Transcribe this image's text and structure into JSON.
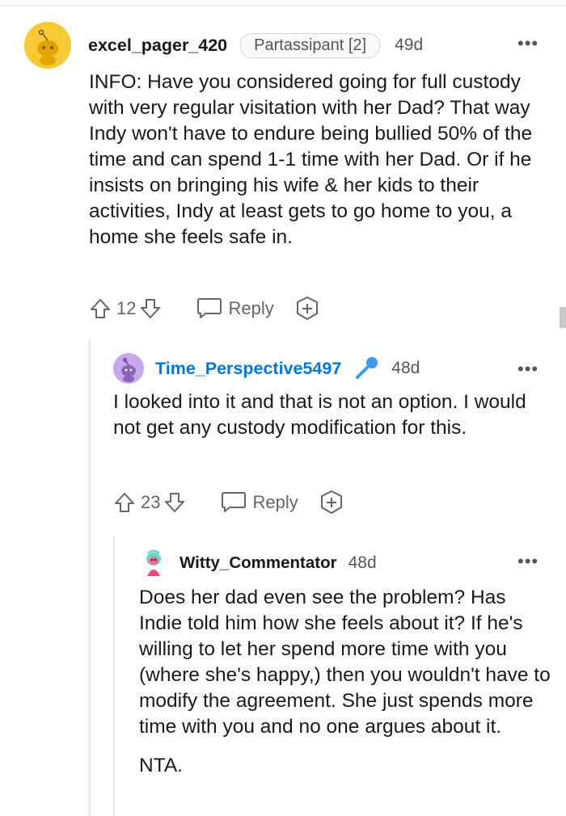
{
  "comments": [
    {
      "username": "excel_pager_420",
      "flair": "Partassipant [2]",
      "age": "49d",
      "body": [
        "INFO: Have you considered going for full custody with very regular visitation with her Dad? That way Indy won't have to endure being bullied 50% of the time and can spend 1-1 time with her Dad. Or if he insists on bringing his wife & her kids to their activities, Indy at least gets to go home to you, a home she feels safe in."
      ],
      "upvotes": "12",
      "reply_label": "Reply"
    },
    {
      "username": "Time_Perspective5497",
      "is_op": true,
      "age": "48d",
      "body": [
        "I looked into it and that is not an option. I would not get any custody modification for this."
      ],
      "upvotes": "23",
      "reply_label": "Reply"
    },
    {
      "username": "Witty_Commentator",
      "age": "48d",
      "body": [
        "Does her dad even see the problem? Has Indie told him how she feels about it? If he's willing to let her spend more time with you (where she's happy,) then you wouldn't have to modify the agreement. She just spends more time with you and no one argues about it.",
        "NTA."
      ]
    }
  ],
  "more_icon": "more-dots-icon",
  "colors": {
    "op_username": "#0079d3",
    "mic_icon": "#3d9be9",
    "avatar1_bg": "#f7c934",
    "avatar2_bg": "#c9a7ec",
    "thread_line": "#e6e6e6"
  }
}
